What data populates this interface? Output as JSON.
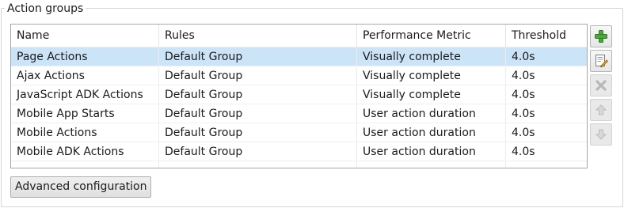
{
  "group": {
    "title": "Action groups"
  },
  "table": {
    "columns": [
      "Name",
      "Rules",
      "Performance Metric",
      "Threshold"
    ],
    "selected_row": 0,
    "rows": [
      {
        "name": "Page Actions",
        "rules": "Default Group",
        "metric": "Visually complete",
        "threshold": "4.0s"
      },
      {
        "name": "Ajax Actions",
        "rules": "Default Group",
        "metric": "Visually complete",
        "threshold": "4.0s"
      },
      {
        "name": "JavaScript ADK Actions",
        "rules": "Default Group",
        "metric": "Visually complete",
        "threshold": "4.0s"
      },
      {
        "name": "Mobile App Starts",
        "rules": "Default Group",
        "metric": "User action duration",
        "threshold": "4.0s"
      },
      {
        "name": "Mobile Actions",
        "rules": "Default Group",
        "metric": "User action duration",
        "threshold": "4.0s"
      },
      {
        "name": "Mobile ADK Actions",
        "rules": "Default Group",
        "metric": "User action duration",
        "threshold": "4.0s"
      }
    ]
  },
  "side_buttons": [
    {
      "icon": "add-icon",
      "enabled": true
    },
    {
      "icon": "edit-icon",
      "enabled": true
    },
    {
      "icon": "delete-icon",
      "enabled": false
    },
    {
      "icon": "move-up-icon",
      "enabled": false
    },
    {
      "icon": "move-down-icon",
      "enabled": false
    }
  ],
  "buttons": {
    "advanced_label": "Advanced configuration"
  },
  "colors": {
    "selection": "#cce4f7",
    "add_green": "#4aa83a"
  }
}
